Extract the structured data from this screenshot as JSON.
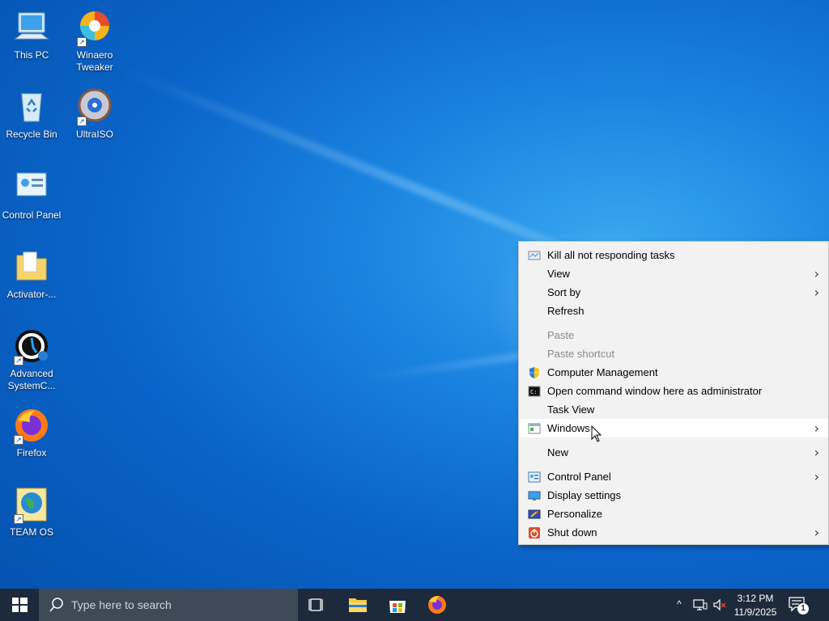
{
  "desktop": {
    "icons": [
      {
        "label": "This PC"
      },
      {
        "label": "Winaero Tweaker"
      },
      {
        "label": "Recycle Bin"
      },
      {
        "label": "UltraISO"
      },
      {
        "label": "Control Panel"
      },
      {
        "label": "Activator-..."
      },
      {
        "label": "Advanced SystemC..."
      },
      {
        "label": "Firefox"
      },
      {
        "label": "TEAM OS"
      }
    ]
  },
  "context_menu": {
    "items": [
      {
        "label": "Kill all not responding tasks",
        "icon": "kill-tasks-icon"
      },
      {
        "label": "View",
        "submenu": true
      },
      {
        "label": "Sort by",
        "submenu": true
      },
      {
        "label": "Refresh"
      },
      {
        "label": "Paste",
        "disabled": true
      },
      {
        "label": "Paste shortcut",
        "disabled": true
      },
      {
        "label": "Computer Management",
        "icon": "shield-icon"
      },
      {
        "label": "Open command window here as administrator",
        "icon": "cmd-icon"
      },
      {
        "label": "Task View"
      },
      {
        "label": "Windows",
        "icon": "window-icon",
        "submenu": true,
        "hovered": true
      },
      {
        "label": "New",
        "submenu": true
      },
      {
        "label": "Control Panel",
        "icon": "control-panel-icon",
        "submenu": true
      },
      {
        "label": "Display settings",
        "icon": "display-icon"
      },
      {
        "label": "Personalize",
        "icon": "personalize-icon"
      },
      {
        "label": "Shut down",
        "icon": "power-icon",
        "submenu": true
      }
    ],
    "arrow_glyph": "›"
  },
  "taskbar": {
    "search_placeholder": "Type here to search",
    "time": "3:12 PM",
    "date": "11/9/2025",
    "notification_count": "1",
    "tray_caret": "^"
  },
  "colors": {
    "desktop_bg": "#0a63c8",
    "taskbar_bg": "#1d2a3b",
    "search_bg": "#3e4a58",
    "menu_bg": "#f2f2f2"
  }
}
